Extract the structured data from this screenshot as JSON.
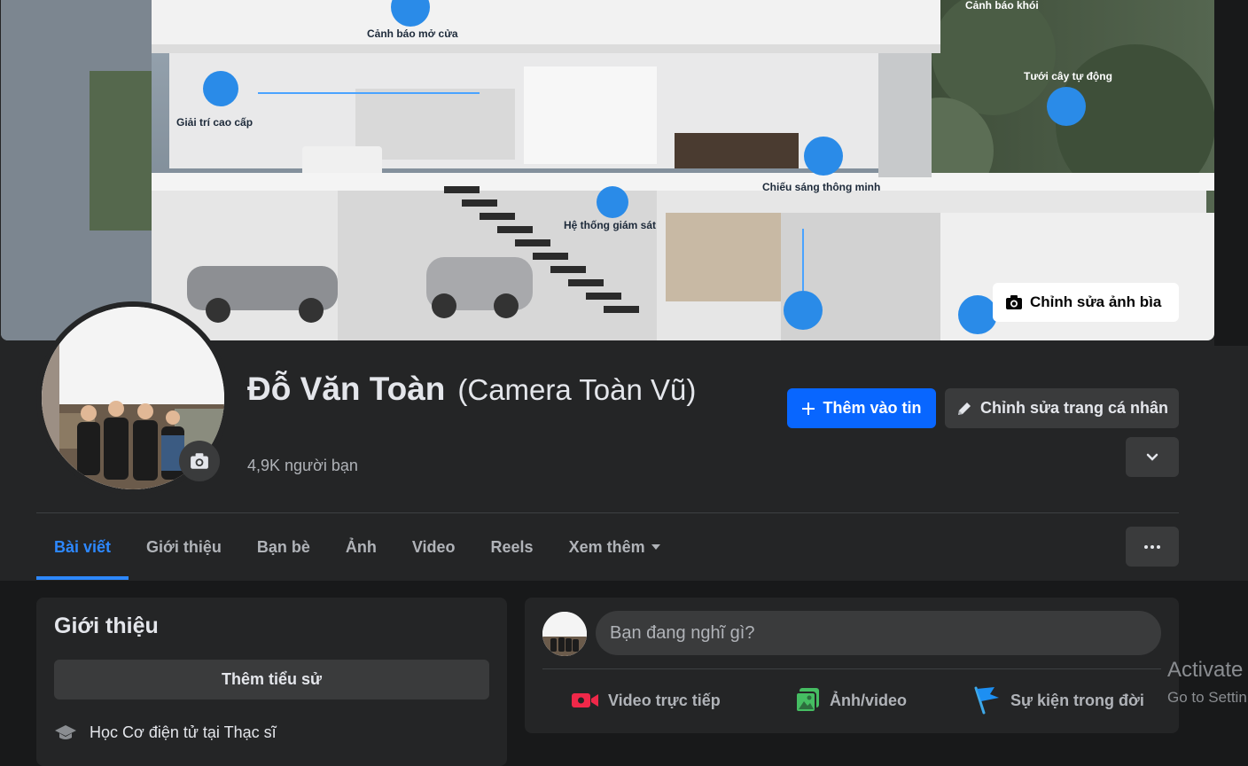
{
  "cover": {
    "edit_label": "Chỉnh sửa ảnh bìa",
    "labels": [
      "Cảnh báo mở cửa",
      "Giải trí cao cấp",
      "Cảnh báo khói",
      "Tưới cây tự động",
      "Chiếu sáng thông minh",
      "Hệ thống giám sát"
    ]
  },
  "profile": {
    "name": "Đỗ Văn Toàn",
    "alt_name": "(Camera Toàn Vũ)",
    "friends": "4,9K người bạn"
  },
  "actions": {
    "add_story": "Thêm vào tin",
    "edit_profile": "Chỉnh sửa trang cá nhân"
  },
  "tabs": [
    {
      "label": "Bài viết",
      "active": true
    },
    {
      "label": "Giới thiệu"
    },
    {
      "label": "Bạn bè"
    },
    {
      "label": "Ảnh"
    },
    {
      "label": "Video"
    },
    {
      "label": "Reels"
    },
    {
      "label": "Xem thêm"
    }
  ],
  "intro": {
    "title": "Giới thiệu",
    "add_bio": "Thêm tiểu sử",
    "education": "Học Cơ điện tử tại Thạc sĩ"
  },
  "composer": {
    "placeholder": "Bạn đang nghĩ gì?",
    "live": "Video trực tiếp",
    "photo": "Ảnh/video",
    "event": "Sự kiện trong đời"
  },
  "watermark": {
    "line1": "Activate",
    "line2": "Go to Settin"
  },
  "colors": {
    "accent": "#0866ff",
    "bg": "#18191a",
    "card": "#242526"
  }
}
